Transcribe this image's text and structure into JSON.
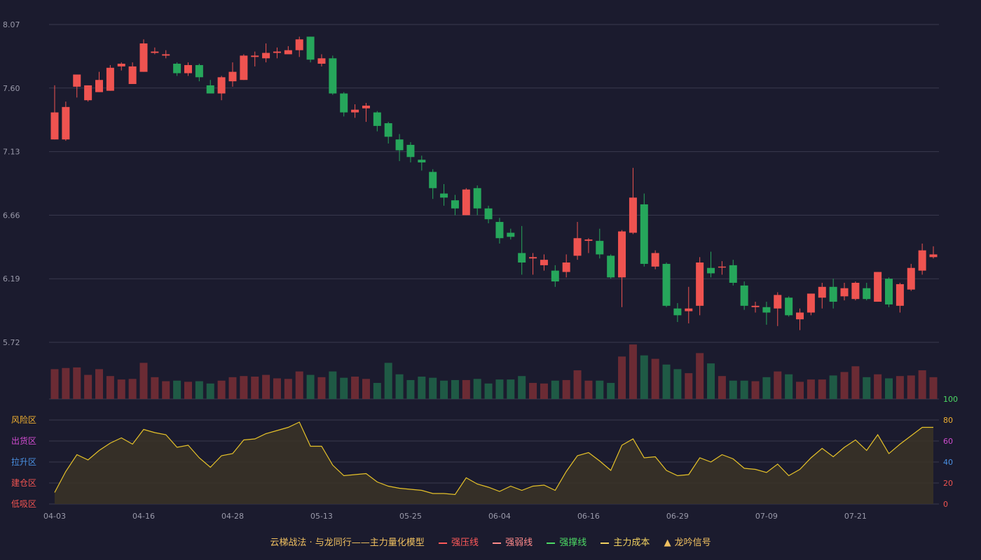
{
  "colors": {
    "up": "#ef5350",
    "down": "#26a65b",
    "up_vol": "#6b2b34",
    "down_vol": "#1f5a45",
    "line": "#e6c229",
    "fill": "#3a3326",
    "grid": "#3a3a4e",
    "text": "#9a9aaa"
  },
  "legend": [
    {
      "label": "云梯战法 · 与龙同行——主力量化模型",
      "color": "#f0c060",
      "swatch": "none"
    },
    {
      "label": "强压线",
      "color": "#ff5a5a",
      "swatch": "solid"
    },
    {
      "label": "强弱线",
      "color": "#ff8a8a",
      "swatch": "dash"
    },
    {
      "label": "强撑线",
      "color": "#4cd964",
      "swatch": "solid"
    },
    {
      "label": "主力成本",
      "color": "#f0d060",
      "swatch": "dash"
    },
    {
      "label": "龙吟信号",
      "color": "#f0c060",
      "swatch": "triangle"
    }
  ],
  "chart_data": {
    "type": "candlestick",
    "ylim": [
      5.72,
      8.07
    ],
    "y_ticks": [
      "8.07",
      "7.60",
      "7.13",
      "6.66",
      "6.19",
      "5.72"
    ],
    "x_ticks": [
      {
        "label": "04-03",
        "i": 0
      },
      {
        "label": "04-16",
        "i": 8
      },
      {
        "label": "04-28",
        "i": 16
      },
      {
        "label": "05-13",
        "i": 24
      },
      {
        "label": "05-25",
        "i": 32
      },
      {
        "label": "06-04",
        "i": 40
      },
      {
        "label": "06-16",
        "i": 48
      },
      {
        "label": "06-29",
        "i": 56
      },
      {
        "label": "07-09",
        "i": 64
      },
      {
        "label": "07-21",
        "i": 72
      }
    ],
    "candles": [
      [
        7.22,
        7.42,
        7.22,
        7.62
      ],
      [
        7.22,
        7.46,
        7.21,
        7.5
      ],
      [
        7.61,
        7.7,
        7.53,
        7.7
      ],
      [
        7.51,
        7.62,
        7.5,
        7.62
      ],
      [
        7.57,
        7.66,
        7.57,
        7.72
      ],
      [
        7.58,
        7.75,
        7.58,
        7.77
      ],
      [
        7.76,
        7.78,
        7.73,
        7.79
      ],
      [
        7.63,
        7.76,
        7.63,
        7.79
      ],
      [
        7.72,
        7.93,
        7.72,
        7.96
      ],
      [
        7.86,
        7.87,
        7.85,
        7.9
      ],
      [
        7.84,
        7.85,
        7.82,
        7.88
      ],
      [
        7.78,
        7.71,
        7.69,
        7.79
      ],
      [
        7.71,
        7.77,
        7.69,
        7.79
      ],
      [
        7.77,
        7.68,
        7.65,
        7.78
      ],
      [
        7.62,
        7.56,
        7.56,
        7.66
      ],
      [
        7.56,
        7.68,
        7.51,
        7.69
      ],
      [
        7.65,
        7.72,
        7.61,
        7.79
      ],
      [
        7.66,
        7.84,
        7.66,
        7.85
      ],
      [
        7.83,
        7.84,
        7.76,
        7.87
      ],
      [
        7.82,
        7.86,
        7.79,
        7.93
      ],
      [
        7.86,
        7.87,
        7.82,
        7.9
      ],
      [
        7.85,
        7.88,
        7.85,
        7.91
      ],
      [
        7.88,
        7.96,
        7.83,
        7.98
      ],
      [
        7.98,
        7.81,
        7.79,
        7.98
      ],
      [
        7.78,
        7.82,
        7.76,
        7.85
      ],
      [
        7.82,
        7.56,
        7.55,
        7.84
      ],
      [
        7.56,
        7.42,
        7.39,
        7.57
      ],
      [
        7.42,
        7.44,
        7.38,
        7.48
      ],
      [
        7.45,
        7.47,
        7.35,
        7.49
      ],
      [
        7.42,
        7.32,
        7.28,
        7.43
      ],
      [
        7.34,
        7.24,
        7.19,
        7.35
      ],
      [
        7.22,
        7.14,
        7.06,
        7.26
      ],
      [
        7.18,
        7.09,
        7.05,
        7.2
      ],
      [
        7.07,
        7.05,
        6.99,
        7.1
      ],
      [
        6.98,
        6.86,
        6.78,
        7.0
      ],
      [
        6.82,
        6.79,
        6.73,
        6.89
      ],
      [
        6.77,
        6.71,
        6.66,
        6.81
      ],
      [
        6.66,
        6.85,
        6.66,
        6.86
      ],
      [
        6.86,
        6.71,
        6.66,
        6.88
      ],
      [
        6.71,
        6.63,
        6.6,
        6.73
      ],
      [
        6.61,
        6.49,
        6.45,
        6.64
      ],
      [
        6.53,
        6.5,
        6.48,
        6.56
      ],
      [
        6.38,
        6.31,
        6.22,
        6.58
      ],
      [
        6.34,
        6.35,
        6.22,
        6.38
      ],
      [
        6.29,
        6.33,
        6.25,
        6.37
      ],
      [
        6.25,
        6.17,
        6.13,
        6.29
      ],
      [
        6.24,
        6.31,
        6.2,
        6.37
      ],
      [
        6.36,
        6.49,
        6.33,
        6.61
      ],
      [
        6.47,
        6.48,
        6.38,
        6.49
      ],
      [
        6.47,
        6.37,
        6.34,
        6.56
      ],
      [
        6.36,
        6.2,
        6.19,
        6.37
      ],
      [
        6.2,
        6.54,
        5.98,
        6.55
      ],
      [
        6.53,
        6.79,
        6.52,
        7.01
      ],
      [
        6.74,
        6.3,
        6.28,
        6.82
      ],
      [
        6.28,
        6.38,
        6.26,
        6.4
      ],
      [
        6.3,
        5.99,
        5.98,
        6.31
      ],
      [
        5.97,
        5.92,
        5.87,
        6.01
      ],
      [
        5.95,
        5.97,
        5.86,
        6.13
      ],
      [
        5.99,
        6.31,
        5.92,
        6.35
      ],
      [
        6.27,
        6.23,
        6.2,
        6.39
      ],
      [
        6.28,
        6.28,
        6.22,
        6.32
      ],
      [
        6.29,
        6.16,
        6.14,
        6.33
      ],
      [
        6.14,
        5.99,
        5.96,
        6.17
      ],
      [
        5.98,
        5.99,
        5.94,
        6.02
      ],
      [
        5.98,
        5.94,
        5.85,
        6.02
      ],
      [
        5.97,
        6.07,
        5.84,
        6.09
      ],
      [
        6.05,
        5.92,
        5.91,
        6.06
      ],
      [
        5.89,
        5.94,
        5.81,
        5.97
      ],
      [
        5.94,
        6.08,
        5.92,
        6.08
      ],
      [
        6.05,
        6.13,
        5.97,
        6.16
      ],
      [
        6.13,
        6.02,
        5.97,
        6.19
      ],
      [
        6.06,
        6.12,
        6.03,
        6.16
      ],
      [
        6.04,
        6.16,
        6.03,
        6.17
      ],
      [
        6.12,
        6.04,
        6.03,
        6.16
      ],
      [
        6.02,
        6.24,
        6.02,
        6.24
      ],
      [
        6.19,
        6.0,
        5.98,
        6.2
      ],
      [
        5.99,
        6.15,
        5.94,
        6.16
      ],
      [
        6.11,
        6.27,
        6.1,
        6.3
      ],
      [
        6.25,
        6.4,
        6.22,
        6.45
      ],
      [
        6.35,
        6.37,
        6.34,
        6.43
      ]
    ],
    "volume": [
      0.52,
      0.54,
      0.55,
      0.42,
      0.52,
      0.4,
      0.34,
      0.35,
      0.63,
      0.38,
      0.31,
      0.32,
      0.3,
      0.31,
      0.27,
      0.32,
      0.38,
      0.4,
      0.39,
      0.42,
      0.36,
      0.35,
      0.48,
      0.42,
      0.38,
      0.48,
      0.37,
      0.39,
      0.35,
      0.28,
      0.63,
      0.43,
      0.33,
      0.39,
      0.37,
      0.32,
      0.33,
      0.33,
      0.35,
      0.27,
      0.34,
      0.34,
      0.4,
      0.28,
      0.27,
      0.32,
      0.33,
      0.5,
      0.32,
      0.32,
      0.28,
      0.74,
      0.95,
      0.76,
      0.7,
      0.6,
      0.52,
      0.45,
      0.8,
      0.62,
      0.4,
      0.32,
      0.32,
      0.31,
      0.38,
      0.48,
      0.43,
      0.3,
      0.34,
      0.34,
      0.41,
      0.47,
      0.57,
      0.38,
      0.43,
      0.36,
      0.4,
      0.41,
      0.5,
      0.38
    ],
    "indicator": {
      "ylim": [
        0,
        100
      ],
      "right_ticks": [
        {
          "label": "100",
          "color": "#4cd964"
        },
        {
          "label": "80",
          "color": "#f0b030"
        },
        {
          "label": "60",
          "color": "#d04cd0"
        },
        {
          "label": "40",
          "color": "#4a90e2"
        },
        {
          "label": "20",
          "color": "#ef5350"
        },
        {
          "label": "0",
          "color": "#ef5350"
        }
      ],
      "zones": [
        {
          "label": "风险区",
          "color": "#f0b030",
          "level": 80
        },
        {
          "label": "出货区",
          "color": "#d04cd0",
          "level": 60
        },
        {
          "label": "拉升区",
          "color": "#4a90e2",
          "level": 40
        },
        {
          "label": "建仓区",
          "color": "#ef5350",
          "level": 20
        },
        {
          "label": "低吸区",
          "color": "#ef5350",
          "level": 0
        }
      ],
      "values": [
        11,
        31,
        47,
        42,
        51,
        58,
        63,
        57,
        71,
        68,
        66,
        54,
        56,
        44,
        35,
        46,
        48,
        61,
        62,
        67,
        70,
        73,
        78,
        55,
        55,
        37,
        27,
        28,
        29,
        21,
        17,
        15,
        14,
        13,
        10,
        10,
        9,
        25,
        19,
        16,
        12,
        17,
        13,
        17,
        18,
        13,
        31,
        46,
        49,
        41,
        32,
        56,
        62,
        44,
        45,
        32,
        27,
        28,
        44,
        40,
        47,
        43,
        34,
        33,
        30,
        38,
        27,
        33,
        44,
        53,
        45,
        54,
        61,
        51,
        66,
        48,
        57,
        65,
        73,
        73
      ]
    }
  }
}
